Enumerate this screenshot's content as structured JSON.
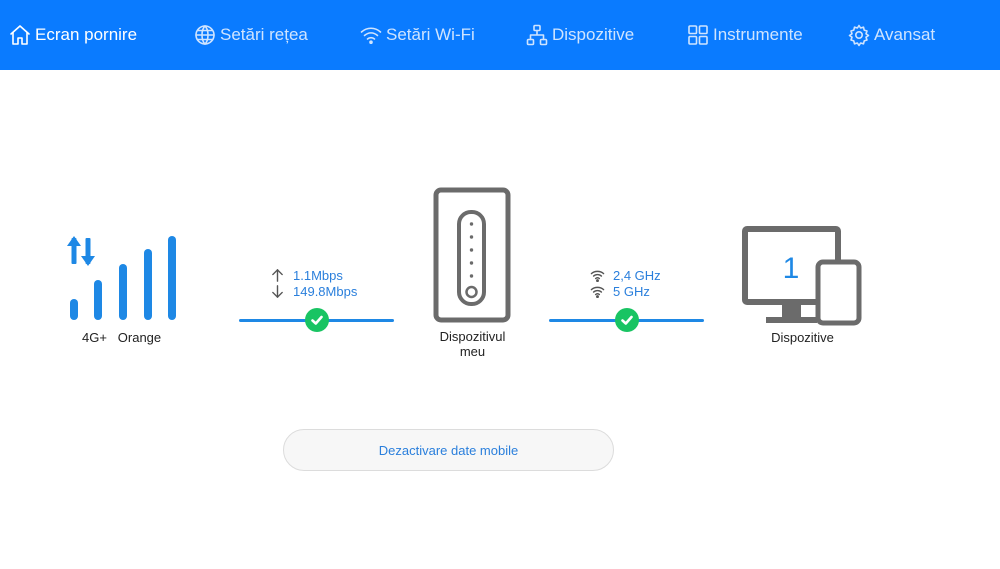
{
  "nav": {
    "items": [
      {
        "label": "Ecran pornire",
        "icon": "home-icon",
        "active": true
      },
      {
        "label": "Setări rețea",
        "icon": "globe-icon"
      },
      {
        "label": "Setări Wi-Fi",
        "icon": "wifi-icon"
      },
      {
        "label": "Dispozitive",
        "icon": "network-icon"
      },
      {
        "label": "Instrumente",
        "icon": "tools-icon"
      },
      {
        "label": "Avansat",
        "icon": "gear-icon"
      }
    ]
  },
  "network": {
    "type": "4G+",
    "operator": "Orange",
    "signal_bars_total": 5,
    "signal_bars_active": 5,
    "upload": "1.1Mbps",
    "download": "149.8Mbps"
  },
  "device": {
    "label": "Dispozitivul meu"
  },
  "wifi": {
    "band1": "2,4 GHz",
    "band2": "5 GHz"
  },
  "clients": {
    "count": "1",
    "label": "Dispozitive"
  },
  "actions": {
    "disable_mobile_data": "Dezactivare date mobile"
  },
  "colors": {
    "header": "#0a7bff",
    "accent": "#1e88e5",
    "ok": "#19c463",
    "device_gray": "#6b6b6b"
  }
}
